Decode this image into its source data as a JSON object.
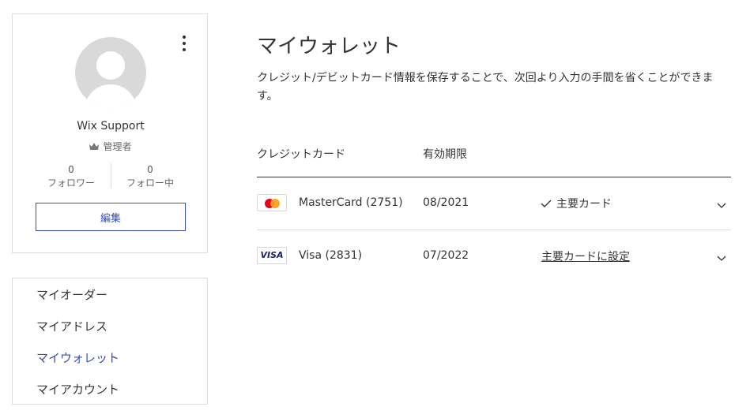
{
  "profile": {
    "name": "Wix Support",
    "role": "管理者",
    "followers_count": "0",
    "followers_label": "フォロワー",
    "following_count": "0",
    "following_label": "フォロー中",
    "edit_button": "編集",
    "more_icon": "kebab-menu-icon",
    "role_icon": "crown-icon"
  },
  "nav": {
    "items": [
      {
        "label": "マイオーダー",
        "active": false
      },
      {
        "label": "マイアドレス",
        "active": false
      },
      {
        "label": "マイウォレット",
        "active": true
      },
      {
        "label": "マイアカウント",
        "active": false
      }
    ]
  },
  "main": {
    "title": "マイウォレット",
    "description": "クレジット/デビットカード情報を保存することで、次回より入力の手間を省くことができます。",
    "headers": {
      "card": "クレジットカード",
      "expiry": "有効期限"
    },
    "cards": [
      {
        "brand_icon": "mastercard-logo",
        "name": "MasterCard (2751)",
        "expiry": "08/2021",
        "status": "主要カード",
        "is_primary": true
      },
      {
        "brand_icon": "visa-logo",
        "logo_text": "VISA",
        "name": "Visa (2831)",
        "expiry": "07/2022",
        "status": "主要カードに設定",
        "is_primary": false
      }
    ]
  },
  "colors": {
    "accent": "#3b4cb4",
    "border": "#dcdcdc",
    "text": "#333333",
    "muted": "#666666"
  }
}
